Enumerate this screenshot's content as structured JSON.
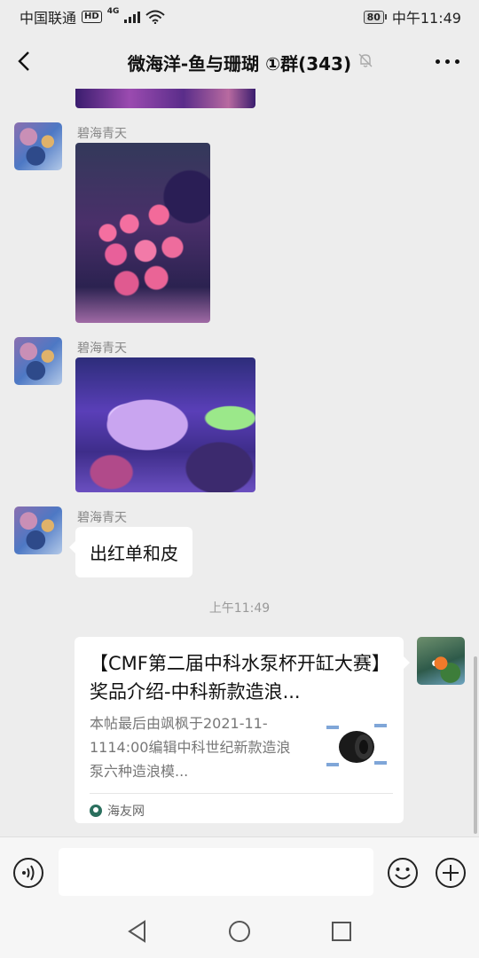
{
  "status_bar": {
    "carrier": "中国联通",
    "hd": "HD",
    "network": "4G",
    "battery": "80",
    "time": "中午11:49"
  },
  "header": {
    "title": "微海洋-鱼与珊瑚 ①群(343)",
    "back_icon": "chevron-left-icon",
    "mute_icon": "bell-off-icon",
    "more_icon": "more-dots-icon"
  },
  "messages": [
    {
      "sender": "碧海青天",
      "type": "image",
      "content": "pink zoanthid coral colonies in aquarium"
    },
    {
      "sender": "碧海青天",
      "type": "image",
      "content": "purple and green coral under blue light"
    },
    {
      "sender": "碧海青天",
      "type": "text",
      "text": "出红单和皮"
    }
  ],
  "timestamp": "上午11:49",
  "shared_card": {
    "title": "【CMF第二届中科水泵杯开缸大赛】奖品介绍-中科新款造浪...",
    "description": "本帖最后由飒枫于2021-11-1114:00编辑中科世纪新款造浪泵六种造浪模...",
    "source": "海友网"
  },
  "input_bar": {
    "voice_icon": "voice-icon",
    "emoji_icon": "emoji-icon",
    "plus_icon": "plus-circle-icon",
    "placeholder": ""
  },
  "nav_bar": {
    "back_icon": "triangle-back-icon",
    "home_icon": "circle-home-icon",
    "recent_icon": "square-recent-icon"
  }
}
